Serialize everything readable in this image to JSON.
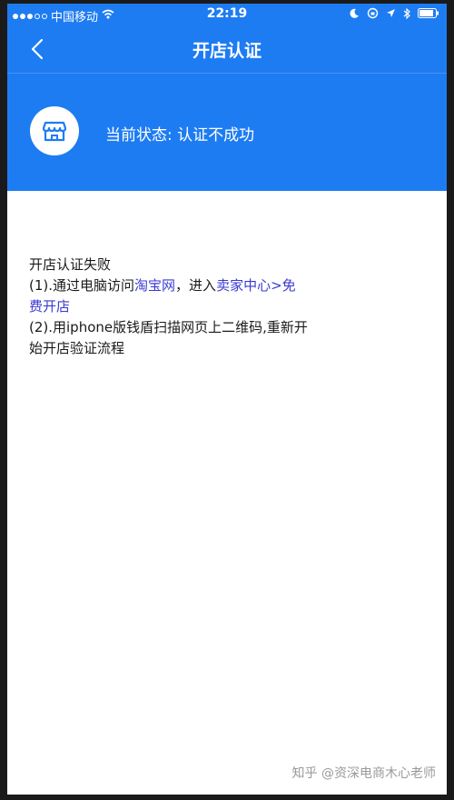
{
  "status_bar": {
    "carrier": "中国移动",
    "time": "22:19"
  },
  "nav": {
    "title": "开店认证"
  },
  "status": {
    "label": "当前状态:",
    "value": "认证不成功"
  },
  "content": {
    "heading": "开店认证失败",
    "step1_prefix": "(1).通过电脑访问",
    "step1_link1": "淘宝网",
    "step1_middle": "，进入",
    "step1_link2a": "卖家中心>免",
    "step1_link2b": "费开店",
    "step2_line1": "(2).用iphone版钱盾扫描网页上二维码,重新开",
    "step2_line2": "始开店验证流程"
  },
  "watermark": "知乎 @资深电商木心老师",
  "colors": {
    "header_blue": "#1e7cf2",
    "link": "#3a3ad0"
  }
}
